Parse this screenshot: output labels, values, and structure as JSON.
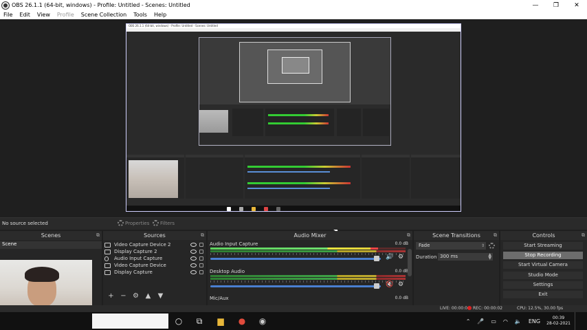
{
  "window": {
    "title": "OBS 26.1.1 (64-bit, windows) - Profile: Untitled - Scenes: Untitled",
    "minimize_glyph": "—",
    "maximize_glyph": "❐",
    "close_glyph": "✕"
  },
  "menu": {
    "items": [
      "File",
      "Edit",
      "View",
      "Profile",
      "Scene Collection",
      "Tools",
      "Help"
    ]
  },
  "preview": {
    "nested_title": "OBS 26.1.1 (64-bit, windows) - Profile: Untitled - Scenes: Untitled"
  },
  "source_toolbar": {
    "no_source": "No source selected",
    "properties": "Properties",
    "filters": "Filters"
  },
  "scenes": {
    "header": "Scenes",
    "items": [
      "Scene"
    ]
  },
  "sources": {
    "header": "Sources",
    "items": [
      {
        "name": "Video Capture Device 2",
        "icon": "camera-icon"
      },
      {
        "name": "Display Capture 2",
        "icon": "monitor-icon"
      },
      {
        "name": "Audio Input Capture",
        "icon": "microphone-icon"
      },
      {
        "name": "Video Capture Device",
        "icon": "camera-icon"
      },
      {
        "name": "Display Capture",
        "icon": "monitor-icon"
      }
    ],
    "tools": [
      "+",
      "−",
      "⚙",
      "▲",
      "▼"
    ]
  },
  "mixer": {
    "header": "Audio Mixer",
    "channels": [
      {
        "name": "Audio Input Capture",
        "db": "0.0 dB",
        "volume_fraction": 0.97,
        "muted": false
      },
      {
        "name": "Desktop Audio",
        "db": "0.0 dB",
        "volume_fraction": 0.97,
        "muted": true
      },
      {
        "name": "Mic/Aux",
        "db": "0.0 dB"
      }
    ]
  },
  "transitions": {
    "header": "Scene Transitions",
    "selected": "Fade",
    "duration_label": "Duration",
    "duration_value": "300 ms"
  },
  "controls": {
    "header": "Controls",
    "buttons": [
      "Start Streaming",
      "Stop Recording",
      "Start Virtual Camera",
      "Studio Mode",
      "Settings",
      "Exit"
    ],
    "active_index": 1
  },
  "status": {
    "live": "LIVE: 00:00:00",
    "rec": "REC: 00:00:02",
    "cpu": "CPU: 12.5%, 30.00 fps"
  },
  "taskbar": {
    "language": "ENG",
    "time": "00:39",
    "date": "28-02-2021"
  },
  "colors": {
    "panel_bg": "#2b2b2b",
    "meter_green": "#5ed35e",
    "meter_yellow": "#e7e53f",
    "meter_red": "#e44444",
    "volume_blue": "#4a7fd0",
    "rec_red": "#d22222"
  }
}
